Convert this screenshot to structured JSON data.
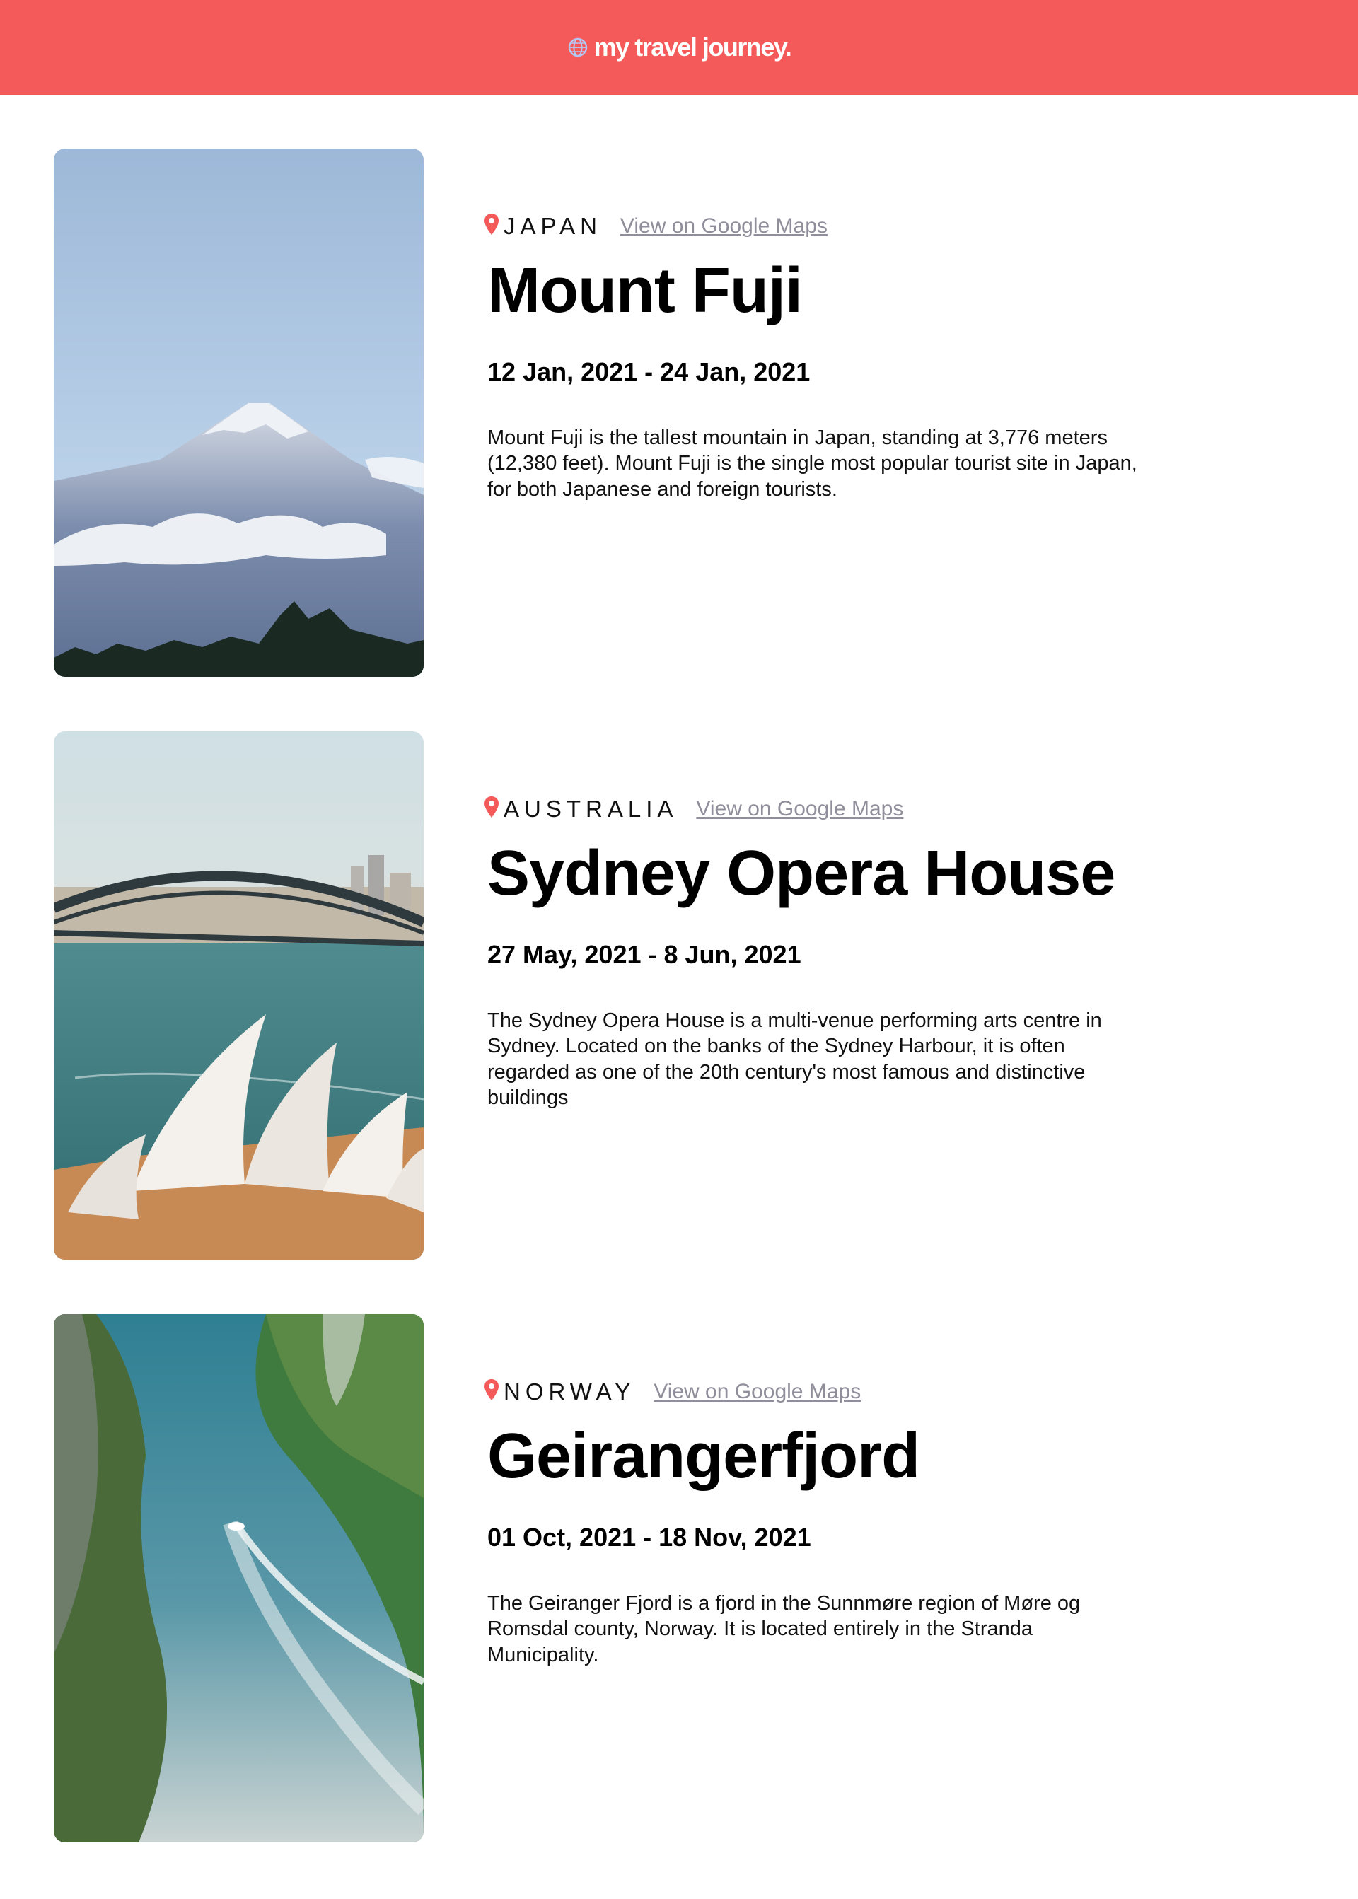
{
  "header": {
    "brand": "my travel journey.",
    "icon": "globe-icon",
    "background": "#F55A5A"
  },
  "entries": [
    {
      "country": "JAPAN",
      "maps_link": "View on Google Maps",
      "title": "Mount Fuji",
      "dates": "12 Jan, 2021 - 24 Jan, 2021",
      "description": "Mount Fuji is the tallest mountain in Japan, standing at 3,776 meters (12,380 feet). Mount Fuji is the single most popular tourist site in Japan, for both Japanese and foreign tourists.",
      "image": "mount-fuji-photo"
    },
    {
      "country": "AUSTRALIA",
      "maps_link": "View on Google Maps",
      "title": "Sydney Opera House",
      "dates": "27 May, 2021 - 8 Jun, 2021",
      "description": "The Sydney Opera House is a multi-venue performing arts centre in Sydney. Located on the banks of the Sydney Harbour, it is often regarded as one of the 20th century's most famous and distinctive buildings",
      "image": "sydney-opera-house-photo"
    },
    {
      "country": "NORWAY",
      "maps_link": "View on Google Maps",
      "title": "Geirangerfjord",
      "dates": "01 Oct, 2021 - 18 Nov, 2021",
      "description": "The Geiranger Fjord is a fjord in the Sunnmøre region of Møre og Romsdal county, Norway. It is located entirely in the Stranda Municipality.",
      "image": "geirangerfjord-photo"
    }
  ],
  "colors": {
    "accent": "#F55A5A",
    "pin": "#F55A5A",
    "link": "#918E9B"
  }
}
